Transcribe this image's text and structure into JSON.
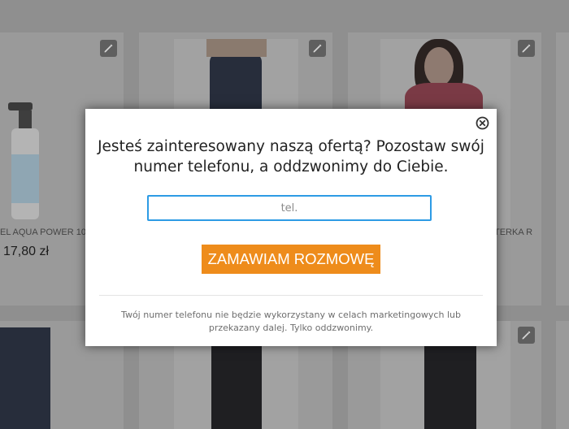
{
  "background": {
    "products": [
      {
        "name": "EL AQUA POWER 10",
        "price": "17,80 zł"
      },
      {
        "name": "TERKA R",
        "price": ""
      }
    ],
    "edit_icon": "pencil-icon"
  },
  "popup": {
    "heading_line1": "Jesteś zainteresowany naszą ofertą? Pozostaw swój",
    "heading_line2": "numer telefonu, a oddzwonimy do Ciebie.",
    "phone_placeholder": "tel.",
    "phone_value": "",
    "submit_label": "ZAMAWIAM ROZMOWĘ",
    "disclaimer_line1": "Twój numer telefonu nie będzie wykorzystany w celach marketingowych lub",
    "disclaimer_line2": "przekazany dalej. Tylko oddzwonimy.",
    "close_icon": "close-circle-icon"
  },
  "colors": {
    "accent_button": "#ee8c1b",
    "input_border": "#2d9be5",
    "overlay": "#8f8f8f"
  }
}
